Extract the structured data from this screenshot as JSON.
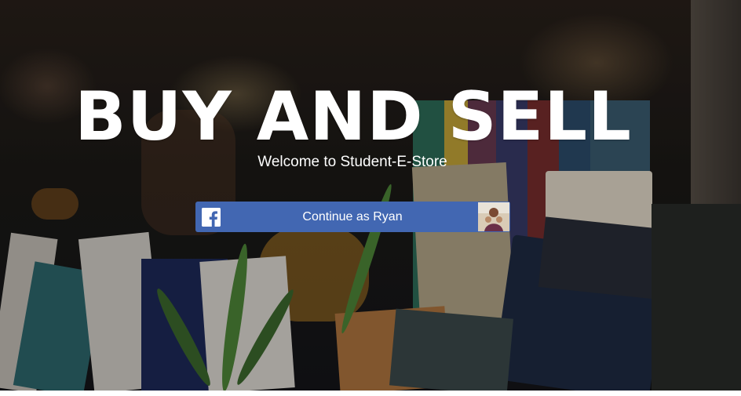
{
  "hero": {
    "title": "BUY AND SELL",
    "welcome_text": "Welcome to Student-E-Store"
  },
  "facebook_button": {
    "label": "Continue as Ryan",
    "brand_color": "#4267b2",
    "icon": "facebook-icon"
  }
}
